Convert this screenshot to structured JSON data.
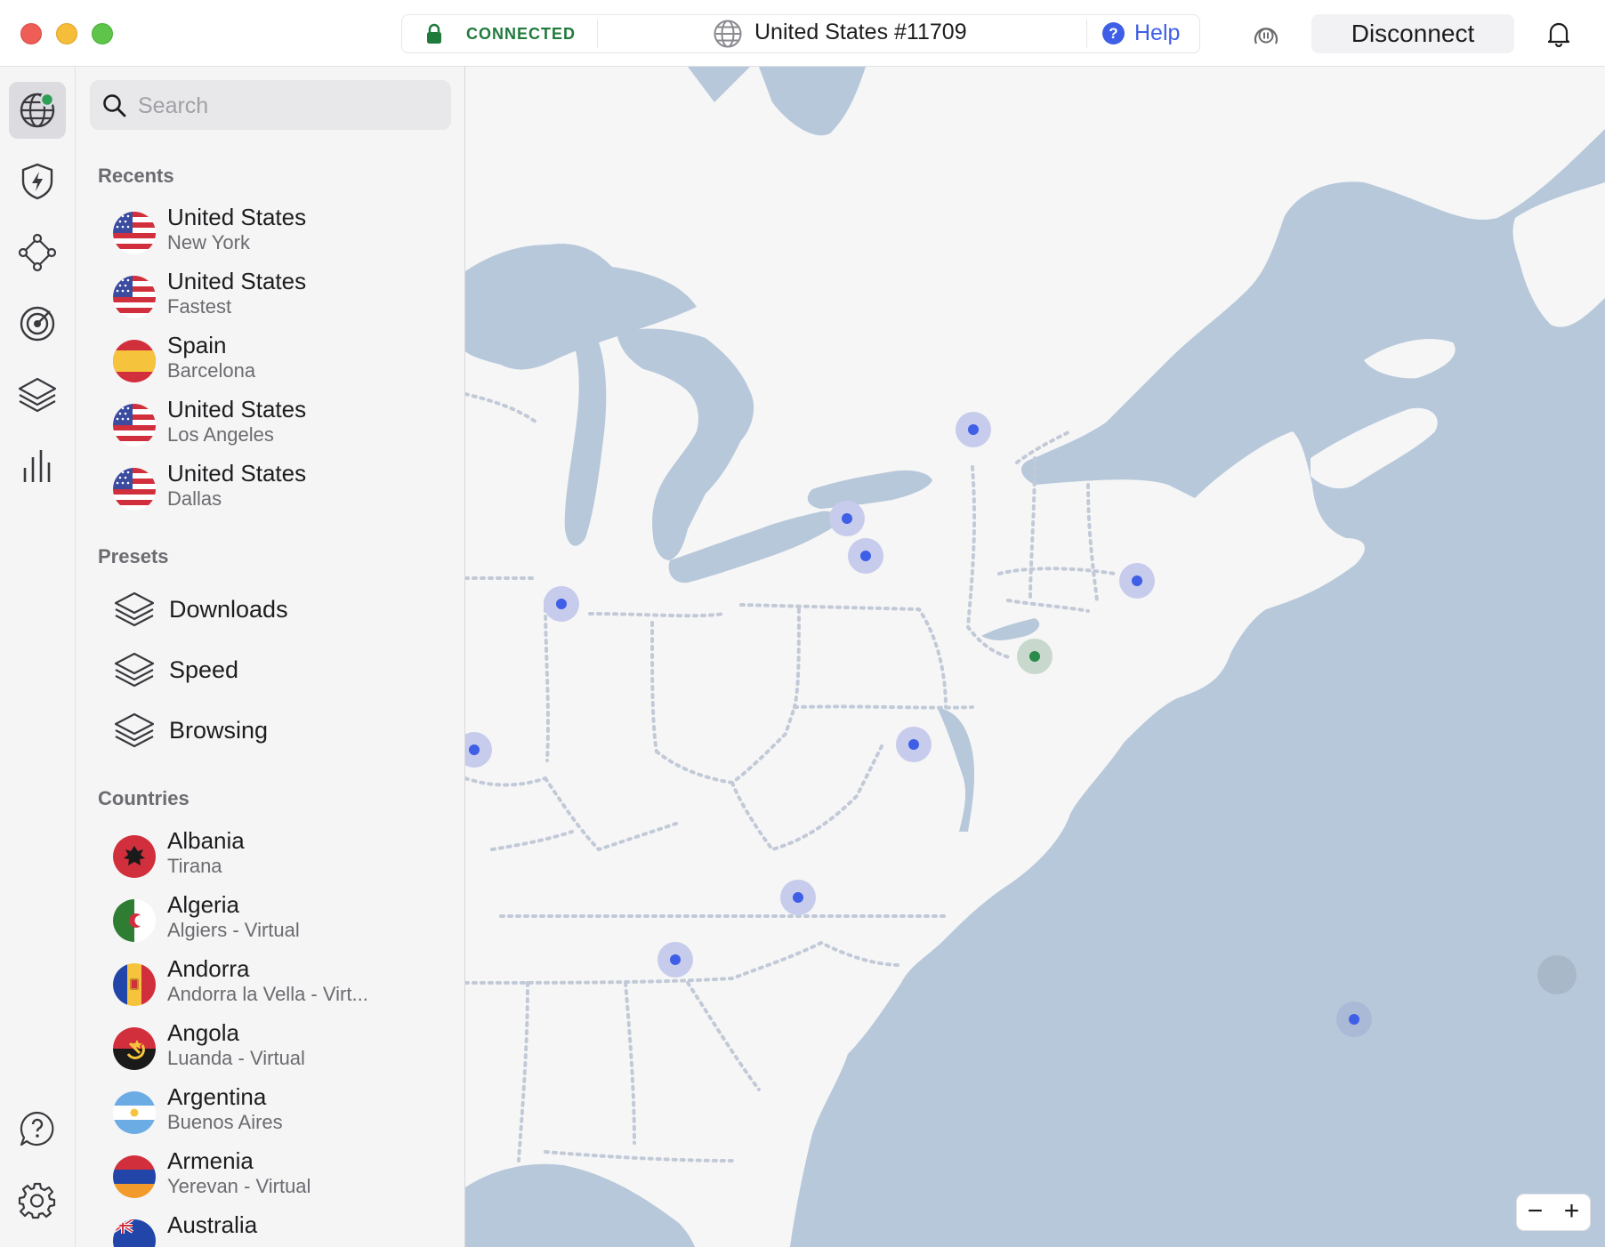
{
  "titlebar": {
    "status": "CONNECTED",
    "server": "United States #11709",
    "help_label": "Help",
    "disconnect_label": "Disconnect"
  },
  "search": {
    "placeholder": "Search",
    "value": ""
  },
  "sections": {
    "recents": "Recents",
    "presets": "Presets",
    "countries": "Countries"
  },
  "recents": [
    {
      "name": "United States",
      "sub": "New York",
      "flag": "us"
    },
    {
      "name": "United States",
      "sub": "Fastest",
      "flag": "us"
    },
    {
      "name": "Spain",
      "sub": "Barcelona",
      "flag": "es"
    },
    {
      "name": "United States",
      "sub": "Los Angeles",
      "flag": "us"
    },
    {
      "name": "United States",
      "sub": "Dallas",
      "flag": "us"
    }
  ],
  "presets": [
    {
      "label": "Downloads"
    },
    {
      "label": "Speed"
    },
    {
      "label": "Browsing"
    }
  ],
  "countries": [
    {
      "name": "Albania",
      "sub": "Tirana",
      "flag": "al"
    },
    {
      "name": "Algeria",
      "sub": "Algiers - Virtual",
      "flag": "dz"
    },
    {
      "name": "Andorra",
      "sub": "Andorra la Vella - Virt...",
      "flag": "ad"
    },
    {
      "name": "Angola",
      "sub": "Luanda - Virtual",
      "flag": "ao"
    },
    {
      "name": "Argentina",
      "sub": "Buenos Aires",
      "flag": "ar"
    },
    {
      "name": "Armenia",
      "sub": "Yerevan - Virtual",
      "flag": "am"
    },
    {
      "name": "Australia",
      "sub": "",
      "flag": "au"
    }
  ],
  "rail": {
    "items": [
      "globe-icon",
      "threat-protection-icon",
      "meshnet-icon",
      "dark-web-monitor-icon",
      "specialty-servers-icon",
      "stats-icon"
    ],
    "bottom": [
      "support-icon",
      "settings-icon"
    ]
  },
  "map": {
    "zoom_out": "−",
    "zoom_in": "+"
  },
  "colors": {
    "accent": "#3e5fe6",
    "connected": "#1f7a3c",
    "land": "#f6f6f6",
    "water": "#b7c8da"
  }
}
